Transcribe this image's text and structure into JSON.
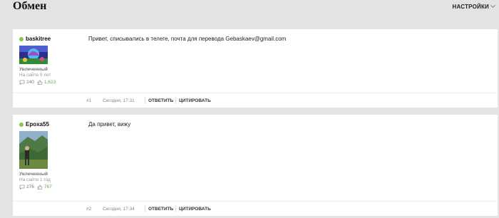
{
  "page": {
    "title": "Обмен",
    "settings_label": "НАСТРОЙКИ"
  },
  "posts": [
    {
      "username": "baskitree",
      "rank": "Увлеченный",
      "since": "На сайте 9 лет",
      "messages": "240",
      "likes": "1,623",
      "text": "Привет, списывались в телеге, почта для перевода Gebaskaev@gmail.com",
      "number": "#1",
      "date": "Сегодня, 17:31",
      "reply_label": "ОТВЕТИТЬ",
      "quote_label": "ЦИТИРОВАТЬ"
    },
    {
      "username": "Epoxa55",
      "rank": "Увлеченный",
      "since": "На сайте 1 год",
      "messages": "276",
      "likes": "767",
      "text": "Да привет, вижу",
      "number": "#2",
      "date": "Сегодня, 17:34",
      "reply_label": "ОТВЕТИТЬ",
      "quote_label": "ЦИТИРОВАТЬ"
    }
  ],
  "colors": {
    "online": "#8bc34a",
    "likes": "#6aa84f",
    "background": "#e3e3e3"
  }
}
